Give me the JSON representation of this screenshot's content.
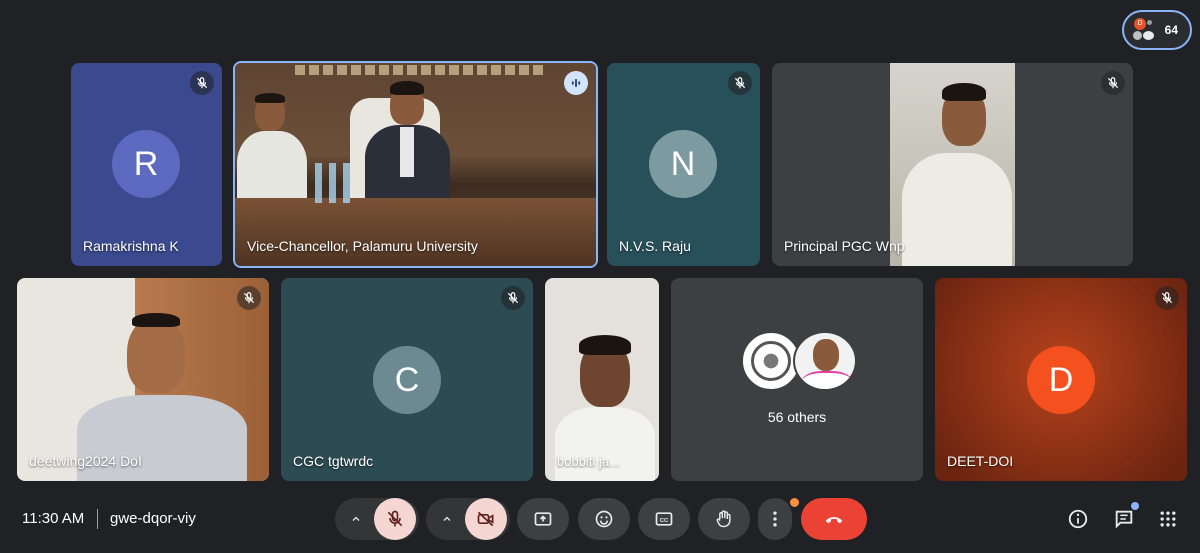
{
  "top": {
    "participant_count": "64"
  },
  "tiles": [
    {
      "name": "Ramakrishna K",
      "initial": "R",
      "color": "#5c6bc0"
    },
    {
      "name": "Vice-Chancellor, Palamuru University"
    },
    {
      "name": "N.V.S. Raju",
      "initial": "N",
      "color": "#7d9aa0"
    },
    {
      "name": "Principal PGC Wnp"
    },
    {
      "name": "deetwing2024 DoI"
    },
    {
      "name": "CGC tgtwrdc",
      "initial": "C",
      "color": "#6b8a91"
    },
    {
      "name": "bobbiti ja..."
    },
    {
      "name": "56 others"
    },
    {
      "name": "DEET-DOI",
      "initial": "D",
      "color": "#f4511e"
    }
  ],
  "bottom_bar": {
    "time": "11:30 AM",
    "meeting_code": "gwe-dqor-viy"
  },
  "icons": {
    "mic_off": "mic-off-icon",
    "cam_off": "videocam-off-icon",
    "present": "present-to-all-icon",
    "emoji": "emoji-icon",
    "captions": "captions-icon",
    "hand": "raise-hand-icon",
    "more": "more-vert-icon",
    "end": "call-end-icon",
    "info": "info-icon",
    "chat": "chat-icon",
    "activities": "apps-icon"
  },
  "colors": {
    "end_call": "#ea4335",
    "active_speaker_border": "#8ab4f8",
    "muted_control": "#f6d6d3"
  }
}
